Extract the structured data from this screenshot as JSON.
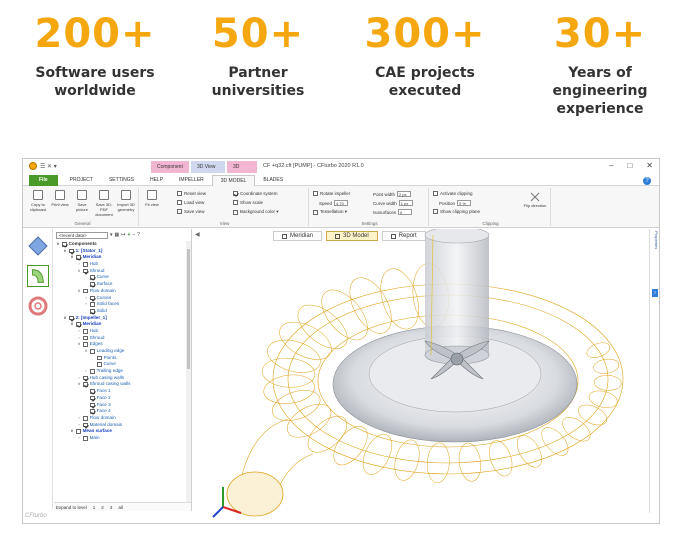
{
  "stats": [
    {
      "number": "200+",
      "label_line1": "Software users",
      "label_line2": "worldwide"
    },
    {
      "number": "50+",
      "label_line1": "Partner",
      "label_line2": "universities"
    },
    {
      "number": "300+",
      "label_line1": "CAE projects",
      "label_line2": "executed"
    },
    {
      "number": "30+",
      "label_line1": "Years of",
      "label_line2": "engineering",
      "label_line3": "experience"
    }
  ],
  "window": {
    "qat": "☰ ✕ ▾",
    "context_tabs": [
      "Component",
      "3D View",
      "3D View"
    ],
    "title": "CF +q32.cft [PUMP] - CFturbo 2020 R1.0",
    "controls": [
      "–",
      "□",
      "✕"
    ],
    "tabs": [
      "File",
      "PROJECT",
      "SETTINGS",
      "HELP",
      "IMPELLER",
      "3D MODEL",
      "BLADES"
    ],
    "active_tab": "3D MODEL",
    "help": "?"
  },
  "ribbon": {
    "general": {
      "label": "General",
      "buttons": [
        "Copy to clipboard",
        "Print view",
        "Save picture",
        "Save 3D-PDF document",
        "Import 3D geometry"
      ]
    },
    "view": {
      "label": "View",
      "fit": "Fit view",
      "items": [
        "Reset view",
        "Load view",
        "Save view"
      ]
    },
    "display": {
      "items": [
        "Coordinate system",
        "Show scale",
        "Background color ▾"
      ]
    },
    "settings": {
      "label": "Settings",
      "rotate": "Rotate impeller",
      "speed_label": "Speed",
      "speed_value": "4.70",
      "tessellation": "Tessellation ▾",
      "point_width_label": "Point width",
      "point_width_value": "2 px",
      "curve_width_label": "Curve width",
      "curve_width_value": "1 px",
      "isosurface_label": "Isosurfaces",
      "isosurface_value": "0"
    },
    "clipping": {
      "label": "Clipping",
      "activate": "Activate clipping",
      "position_label": "Position",
      "position_value": "0 %",
      "show_plane": "Show clipping plane",
      "flip": "Flip direction"
    }
  },
  "tree": {
    "combo": "<recent data>",
    "expand_label": "Expand to level",
    "levels": [
      "1",
      "2",
      "3",
      "all"
    ],
    "items": [
      {
        "text": "Components",
        "indent": 0,
        "style": "bold",
        "cb": "on",
        "exp": "∨"
      },
      {
        "text": "1: [Stator_1]",
        "indent": 1,
        "style": "blue",
        "cb": "on",
        "exp": "∨"
      },
      {
        "text": "Meridian",
        "indent": 2,
        "style": "blue",
        "cb": "on",
        "exp": "∨"
      },
      {
        "text": "Hub",
        "indent": 3,
        "style": "",
        "cb": "off",
        "exp": "›"
      },
      {
        "text": "Shroud",
        "indent": 3,
        "style": "",
        "cb": "on",
        "exp": "∨"
      },
      {
        "text": "Curve",
        "indent": 4,
        "style": "",
        "cb": "on",
        "exp": ""
      },
      {
        "text": "Surface",
        "indent": 4,
        "style": "",
        "cb": "on",
        "exp": ""
      },
      {
        "text": "Flow domain",
        "indent": 3,
        "style": "",
        "cb": "off",
        "exp": "∨"
      },
      {
        "text": "Curves",
        "indent": 4,
        "style": "",
        "cb": "on",
        "exp": "›"
      },
      {
        "text": "Solid faces",
        "indent": 4,
        "style": "",
        "cb": "off",
        "exp": "›"
      },
      {
        "text": "Solid",
        "indent": 4,
        "style": "",
        "cb": "on",
        "exp": ""
      },
      {
        "text": "2: [Impeller_1]",
        "indent": 1,
        "style": "blue",
        "cb": "on",
        "exp": "∨"
      },
      {
        "text": "Meridian",
        "indent": 2,
        "style": "blue",
        "cb": "on",
        "exp": "∨"
      },
      {
        "text": "Hub",
        "indent": 3,
        "style": "",
        "cb": "off",
        "exp": "›"
      },
      {
        "text": "Shroud",
        "indent": 3,
        "style": "",
        "cb": "off",
        "exp": "›"
      },
      {
        "text": "Edges",
        "indent": 3,
        "style": "",
        "cb": "off",
        "exp": "∨"
      },
      {
        "text": "Leading edge",
        "indent": 4,
        "style": "",
        "cb": "off",
        "exp": "∨"
      },
      {
        "text": "Points",
        "indent": 5,
        "style": "",
        "cb": "off",
        "exp": ""
      },
      {
        "text": "Curve",
        "indent": 5,
        "style": "",
        "cb": "off",
        "exp": ""
      },
      {
        "text": "Trailing edge",
        "indent": 4,
        "style": "",
        "cb": "off",
        "exp": "›"
      },
      {
        "text": "Hub casing walls",
        "indent": 3,
        "style": "",
        "cb": "on",
        "exp": "›"
      },
      {
        "text": "Shroud casing walls",
        "indent": 3,
        "style": "",
        "cb": "on",
        "exp": "∨"
      },
      {
        "text": "Face 1",
        "indent": 4,
        "style": "",
        "cb": "on",
        "exp": ""
      },
      {
        "text": "Face 2",
        "indent": 4,
        "style": "",
        "cb": "on",
        "exp": ""
      },
      {
        "text": "Face 3",
        "indent": 4,
        "style": "",
        "cb": "on",
        "exp": ""
      },
      {
        "text": "Face 4",
        "indent": 4,
        "style": "",
        "cb": "on",
        "exp": ""
      },
      {
        "text": "Flow domain",
        "indent": 3,
        "style": "",
        "cb": "off",
        "exp": "›"
      },
      {
        "text": "Material domain",
        "indent": 3,
        "style": "",
        "cb": "on",
        "exp": "›"
      },
      {
        "text": "Mean surface",
        "indent": 2,
        "style": "blue",
        "cb": "off",
        "exp": "∨"
      },
      {
        "text": "Main",
        "indent": 3,
        "style": "",
        "cb": "off",
        "exp": "›"
      }
    ]
  },
  "viewport": {
    "tabs": [
      "Meridian",
      "3D Model",
      "Report"
    ],
    "active_tab": "3D Model",
    "side_label": "Properties",
    "badge": "?"
  },
  "brand": "CFturbo",
  "colors": {
    "accent": "#f5a70f",
    "file_tab": "#4a9a2a",
    "wire": "#e0a21a"
  }
}
